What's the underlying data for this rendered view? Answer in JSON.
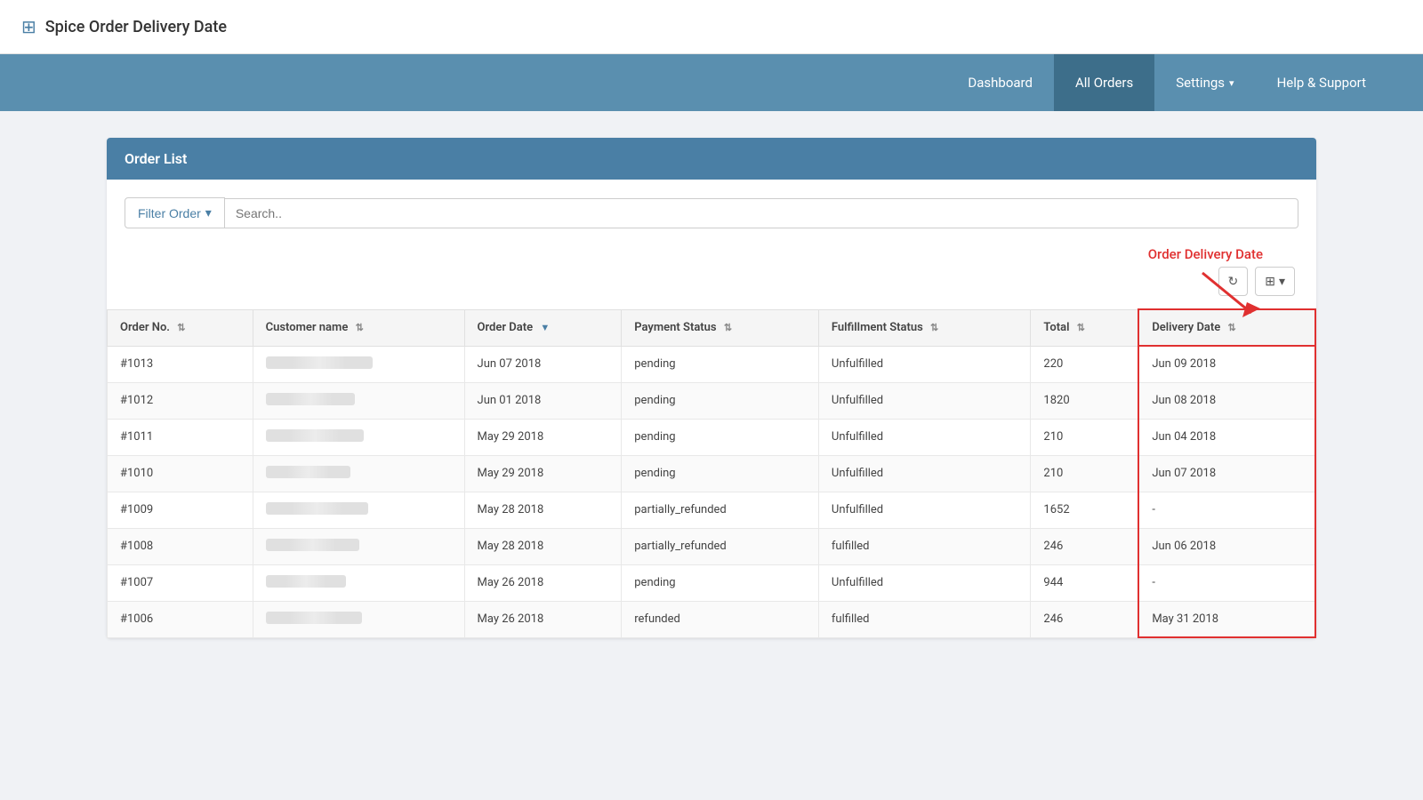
{
  "app": {
    "title": "Spice Order Delivery Date",
    "icon": "⊞"
  },
  "nav": {
    "items": [
      {
        "label": "Dashboard",
        "active": false
      },
      {
        "label": "All Orders",
        "active": true
      },
      {
        "label": "Settings",
        "active": false,
        "hasDropdown": true
      },
      {
        "label": "Help & Support",
        "active": false
      }
    ]
  },
  "orderList": {
    "title": "Order List",
    "filter": {
      "buttonLabel": "Filter Order",
      "searchPlaceholder": "Search.."
    },
    "annotation": {
      "label": "Order Delivery Date"
    },
    "actions": {
      "refresh": "↻",
      "columns": "⊞"
    },
    "columns": [
      {
        "label": "Order No.",
        "sortable": true
      },
      {
        "label": "Customer name",
        "sortable": true
      },
      {
        "label": "Order Date",
        "sortable": true,
        "activeSorted": true
      },
      {
        "label": "Payment Status",
        "sortable": true
      },
      {
        "label": "Fulfillment Status",
        "sortable": true
      },
      {
        "label": "Total",
        "sortable": true
      },
      {
        "label": "Delivery Date",
        "sortable": true
      }
    ],
    "rows": [
      {
        "orderNo": "#1013",
        "customerWidth": 120,
        "orderDate": "Jun 07 2018",
        "paymentStatus": "pending",
        "fulfillmentStatus": "Unfulfilled",
        "total": "220",
        "deliveryDate": "Jun 09 2018"
      },
      {
        "orderNo": "#1012",
        "customerWidth": 100,
        "orderDate": "Jun 01 2018",
        "paymentStatus": "pending",
        "fulfillmentStatus": "Unfulfilled",
        "total": "1820",
        "deliveryDate": "Jun 08 2018"
      },
      {
        "orderNo": "#1011",
        "customerWidth": 110,
        "orderDate": "May 29 2018",
        "paymentStatus": "pending",
        "fulfillmentStatus": "Unfulfilled",
        "total": "210",
        "deliveryDate": "Jun 04 2018"
      },
      {
        "orderNo": "#1010",
        "customerWidth": 95,
        "orderDate": "May 29 2018",
        "paymentStatus": "pending",
        "fulfillmentStatus": "Unfulfilled",
        "total": "210",
        "deliveryDate": "Jun 07 2018"
      },
      {
        "orderNo": "#1009",
        "customerWidth": 115,
        "orderDate": "May 28 2018",
        "paymentStatus": "partially_refunded",
        "fulfillmentStatus": "Unfulfilled",
        "total": "1652",
        "deliveryDate": "-"
      },
      {
        "orderNo": "#1008",
        "customerWidth": 105,
        "orderDate": "May 28 2018",
        "paymentStatus": "partially_refunded",
        "fulfillmentStatus": "fulfilled",
        "total": "246",
        "deliveryDate": "Jun 06 2018"
      },
      {
        "orderNo": "#1007",
        "customerWidth": 90,
        "orderDate": "May 26 2018",
        "paymentStatus": "pending",
        "fulfillmentStatus": "Unfulfilled",
        "total": "944",
        "deliveryDate": "-"
      },
      {
        "orderNo": "#1006",
        "customerWidth": 108,
        "orderDate": "May 26 2018",
        "paymentStatus": "refunded",
        "fulfillmentStatus": "fulfilled",
        "total": "246",
        "deliveryDate": "May 31 2018"
      }
    ]
  }
}
